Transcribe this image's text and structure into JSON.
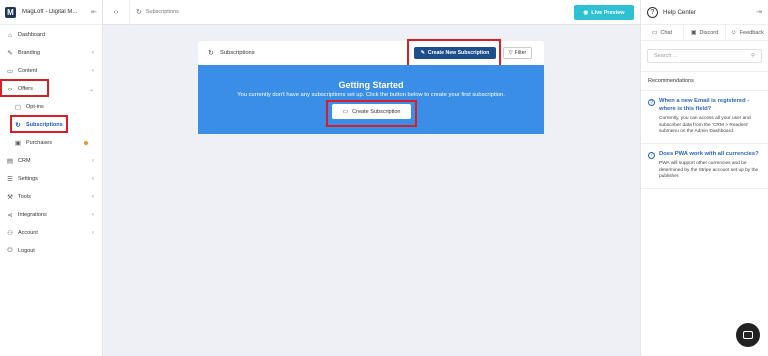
{
  "brand": {
    "name": "MagLoft - Digital M...",
    "logo": "M"
  },
  "sidebar": {
    "items": [
      {
        "label": "Dashboard",
        "icon": "home-icon"
      },
      {
        "label": "Branding",
        "icon": "brush-icon"
      },
      {
        "label": "Content",
        "icon": "folder-icon"
      },
      {
        "label": "Offers",
        "icon": "tag-icon"
      },
      {
        "label": "Opt-ins",
        "icon": "optin-icon"
      },
      {
        "label": "Subscriptions",
        "icon": "refresh-icon"
      },
      {
        "label": "Purchases",
        "icon": "cart-icon"
      },
      {
        "label": "CRM",
        "icon": "crm-icon"
      },
      {
        "label": "Settings",
        "icon": "settings-icon"
      },
      {
        "label": "Tools",
        "icon": "tools-icon"
      },
      {
        "label": "Integrations",
        "icon": "share-icon"
      },
      {
        "label": "Account",
        "icon": "users-icon"
      },
      {
        "label": "Logout",
        "icon": "logout-icon"
      }
    ]
  },
  "topbar": {
    "breadcrumb": "Subscriptions",
    "live_preview": "Live Preview"
  },
  "card": {
    "title": "Subscriptions",
    "create_new_label": "Create New Subscription",
    "filter_label": "Filter"
  },
  "hero": {
    "title": "Getting Started",
    "subtitle": "You currently don't have any subscriptions set up. Click the button below to create your first subscription.",
    "button_label": "Create Subscription"
  },
  "help": {
    "title": "Help Center",
    "tabs": [
      "Chat",
      "Discord",
      "Feedback"
    ],
    "search_placeholder": "Search ...",
    "recommendations_title": "Recommendations",
    "recs": [
      {
        "q": "When a new Email is registered - where is this field?",
        "a": "Currently, you can access all your user and subscriber data from the 'CRM > Readers' submenu on the Admin Dashboard."
      },
      {
        "q": "Does PWA work with all currencies?",
        "a": "PWA will support other currencies and be determined by the Stripe account set up by the publisher."
      }
    ]
  },
  "colors": {
    "accent": "#1f4e8c",
    "hero": "#3a8ee6",
    "live": "#2ec1d3",
    "highlight": "#d91e27",
    "active": "#1a56c7"
  }
}
